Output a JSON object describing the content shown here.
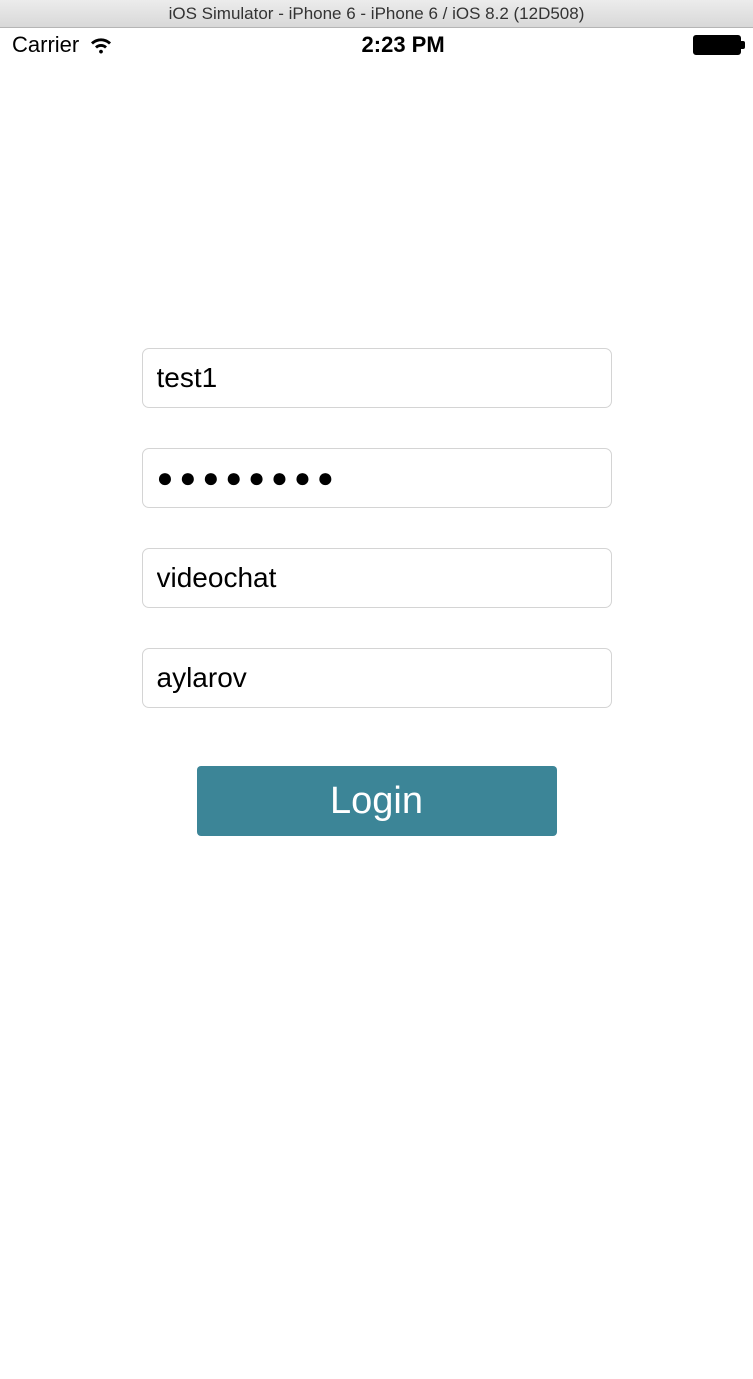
{
  "window": {
    "title": "iOS Simulator - iPhone 6 - iPhone 6 / iOS 8.2 (12D508)"
  },
  "status_bar": {
    "carrier": "Carrier",
    "time": "2:23 PM"
  },
  "form": {
    "field1": "test1",
    "field2_masked": "●●●●●●●●",
    "field3": "videochat",
    "field4": "aylarov",
    "login_label": "Login"
  },
  "colors": {
    "button_bg": "#3c8597"
  }
}
